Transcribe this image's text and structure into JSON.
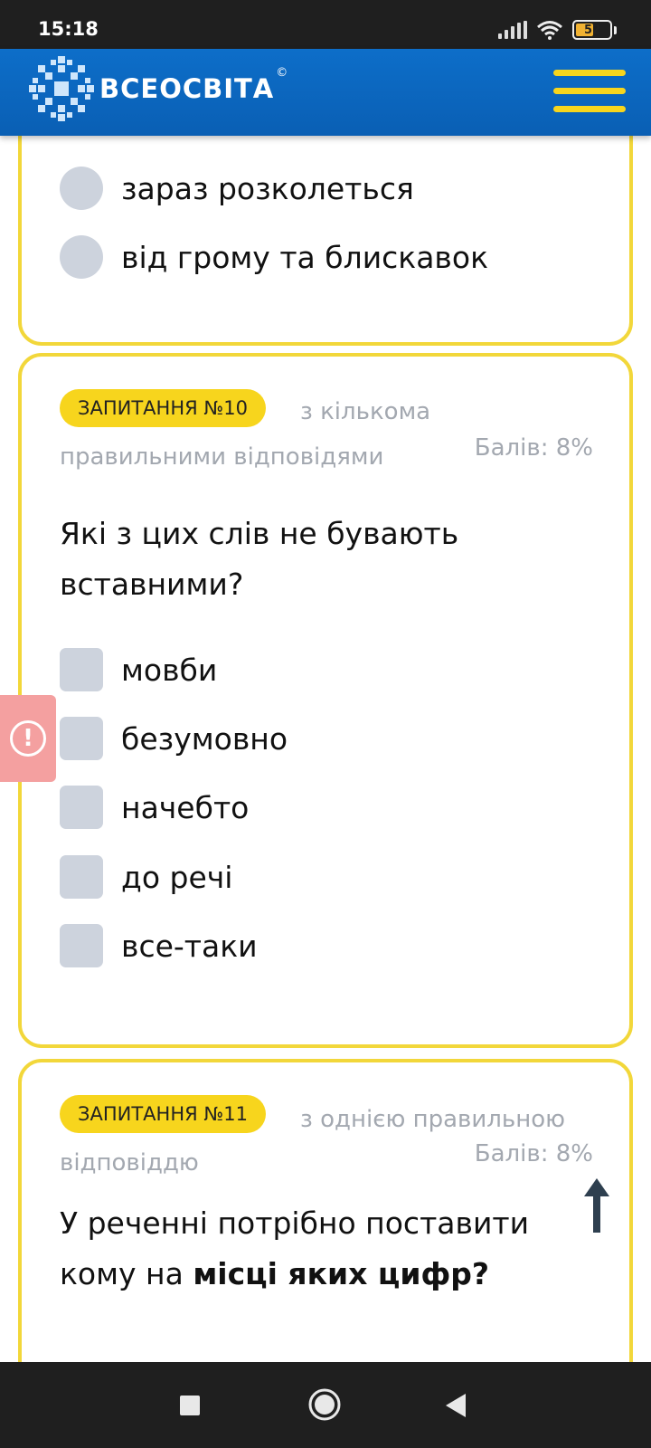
{
  "status_bar": {
    "time": "15:18",
    "battery": "52",
    "battery_level": 0.52
  },
  "header": {
    "logo_text": "ВСЕОСВІТА",
    "logo_mark": "©",
    "menu_icon": "hamburger-icon"
  },
  "prev_question": {
    "options": [
      {
        "label": "зараз розколеться",
        "icon": "radio-icon"
      },
      {
        "label": "від грому та блискавок",
        "icon": "radio-icon"
      }
    ]
  },
  "q10": {
    "badge": "ЗАПИТАННЯ №10",
    "type_line1": "з кількома",
    "type_line2": "правильними відповідями",
    "points": "Балів: 8%",
    "question_line1": "Які з цих слів не бувають",
    "question_line2": "вставними?",
    "options": [
      {
        "label": "мовби",
        "icon": "checkbox-icon"
      },
      {
        "label": "безумовно",
        "icon": "checkbox-icon"
      },
      {
        "label": "начебто",
        "icon": "checkbox-icon"
      },
      {
        "label": "до речі",
        "icon": "checkbox-icon"
      },
      {
        "label": "все-таки",
        "icon": "checkbox-icon"
      }
    ]
  },
  "q11": {
    "badge": "ЗАПИТАННЯ №11",
    "type_line1": "з однією правильною",
    "type_line2": "відповіддю",
    "points": "Балів: 8%",
    "question_line1": "У реченні потрібно поставити",
    "question_line2_plain": "кому на ",
    "question_line2_bold": "місці яких цифр?"
  },
  "feedback": {
    "icon": "exclamation-icon",
    "symbol": "!"
  },
  "scroll_top": {
    "icon": "arrow-up-icon",
    "color": "#2e3f4f"
  },
  "nav_bar": {
    "buttons": [
      "square-icon",
      "circle-icon",
      "back-triangle-icon"
    ]
  },
  "colors": {
    "accent_yellow": "#f7d51d",
    "card_border": "#f2d73a",
    "header_blue": "#0a5fb4",
    "option_grey": "#cdd3dd",
    "muted_text": "#a3a8b0"
  }
}
